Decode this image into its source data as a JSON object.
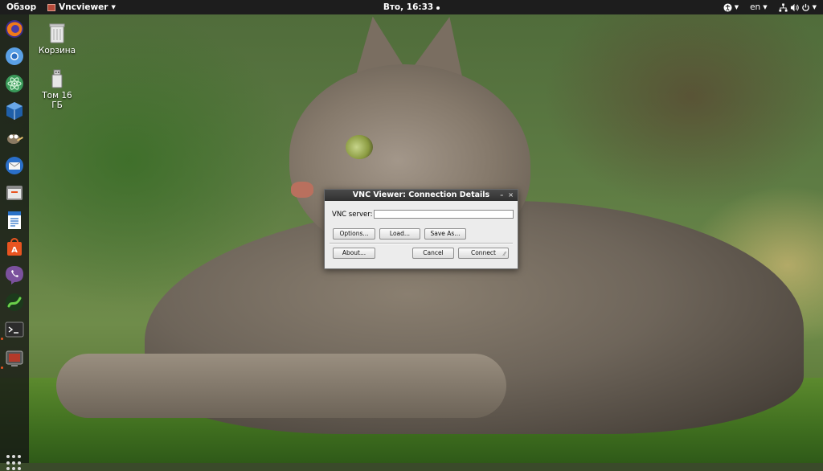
{
  "topbar": {
    "overview_label": "Обзор",
    "app_name": "Vncviewer",
    "clock": "Вто, 16:33",
    "language": "en"
  },
  "desktop": {
    "icons": [
      {
        "label": "Корзина",
        "icon": "trash-icon"
      },
      {
        "label": "Том 16 ГБ",
        "icon": "usb-drive-icon"
      }
    ]
  },
  "dock": {
    "apps": [
      "firefox-icon",
      "chromium-icon",
      "atom-icon",
      "virtualbox-icon",
      "gimp-icon",
      "thunderbird-icon",
      "files-icon",
      "writer-icon",
      "software-center-icon",
      "viber-icon",
      "gnome-snake-icon",
      "terminal-icon",
      "vnc-viewer-icon"
    ]
  },
  "dialog": {
    "title": "VNC Viewer: Connection Details",
    "server_label": "VNC server:",
    "server_value": "",
    "options_label": "Options...",
    "load_label": "Load...",
    "save_as_label": "Save As...",
    "about_label": "About...",
    "cancel_label": "Cancel",
    "connect_label": "Connect"
  },
  "colors": {
    "topbar": "#1d1d1d",
    "accent": "#e95420"
  }
}
